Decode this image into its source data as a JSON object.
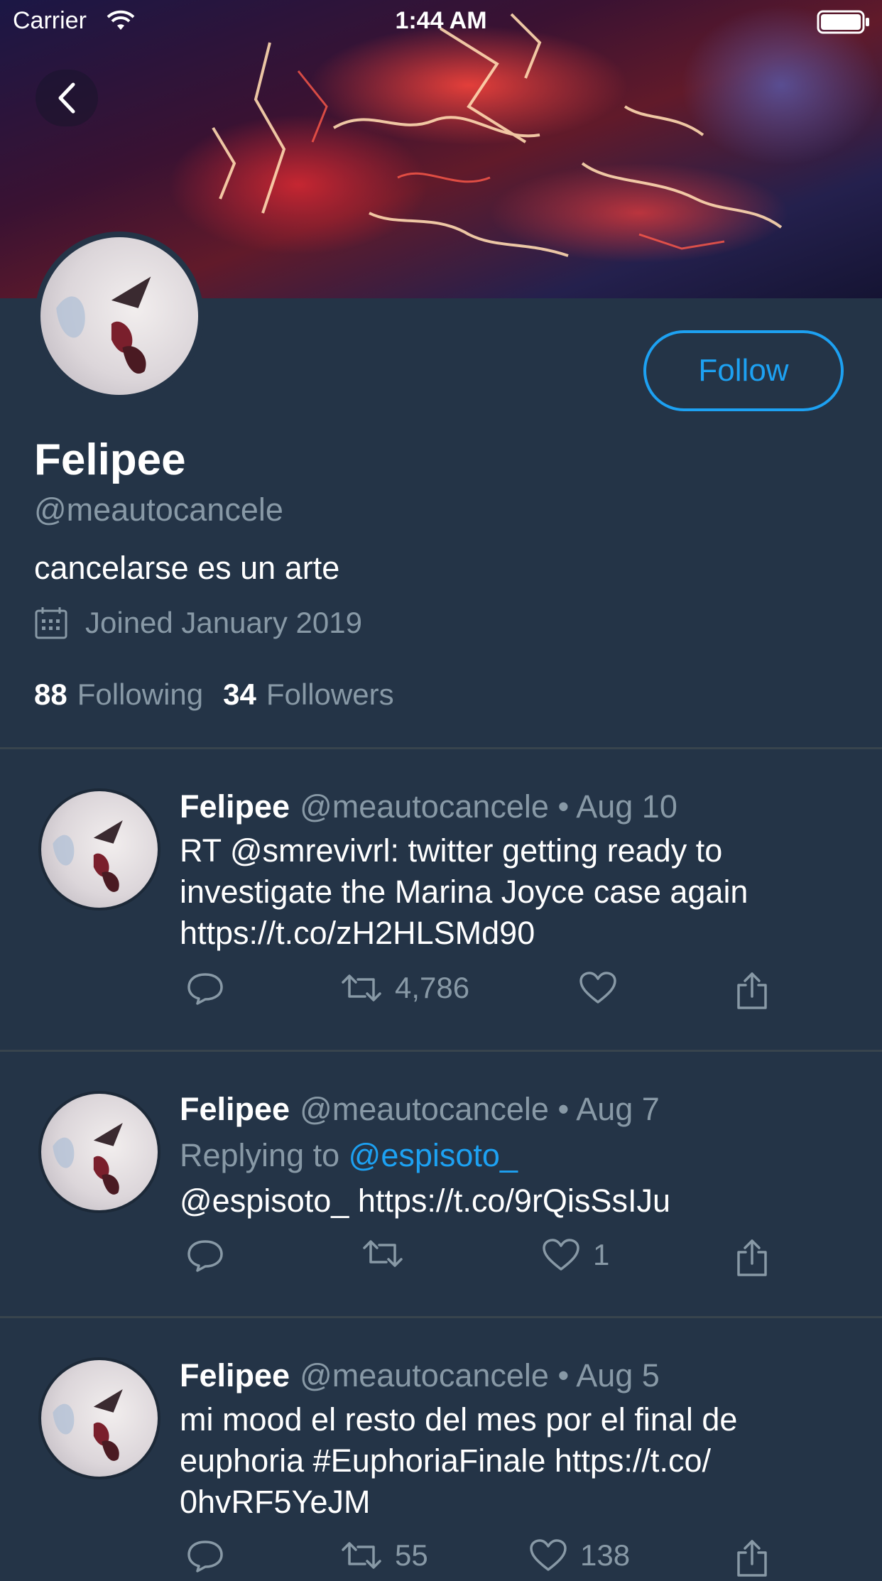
{
  "status_bar": {
    "carrier": "Carrier",
    "time": "1:44 AM"
  },
  "colors": {
    "background": "#243447",
    "accent": "#1da1f2",
    "secondary_text": "#8899a6",
    "divider": "#38444d"
  },
  "profile": {
    "display_name": "Felipee",
    "handle": "@meautocancele",
    "bio": "cancelarse es un arte",
    "joined": "Joined January 2019",
    "following_count": "88",
    "following_label": "Following",
    "followers_count": "34",
    "followers_label": "Followers",
    "follow_button": "Follow"
  },
  "tweets": [
    {
      "name": "Felipee",
      "meta": "@meautocancele • Aug 10",
      "lines": [
        "RT @smrevivrl: twitter getting ready to",
        "investigate the Marina Joyce case again",
        "https://t.co/zH2HLSMd90"
      ],
      "retweets": "4,786",
      "likes": ""
    },
    {
      "name": "Felipee",
      "meta": "@meautocancele • Aug 7",
      "reply_prefix": "Replying to",
      "reply_to": "@espisoto_",
      "lines": [
        "@espisoto_ https://t.co/9rQisSsIJu"
      ],
      "retweets": "",
      "likes": "1"
    },
    {
      "name": "Felipee",
      "meta": "@meautocancele • Aug 5",
      "lines": [
        "mi mood el resto del mes por el final de",
        "euphoria #EuphoriaFinale https://t.co/",
        "0hvRF5YeJM"
      ],
      "retweets": "55",
      "likes": "138"
    }
  ]
}
